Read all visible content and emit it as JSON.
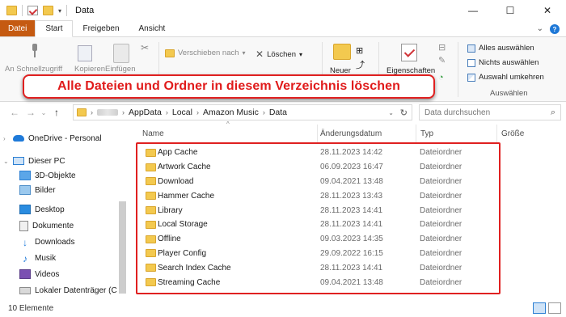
{
  "window": {
    "title": "Data",
    "controls": [
      "—",
      "☐",
      "✕"
    ]
  },
  "ribbon_tabs": {
    "file": "Datei",
    "start": "Start",
    "share": "Freigeben",
    "view": "Ansicht"
  },
  "ribbon": {
    "pin_label": "An Schnellzugriff",
    "copy_label": "Kopieren",
    "paste_label": "Einfügen",
    "move_to": "Verschieben nach",
    "delete": "Löschen",
    "new_label": "Neuer",
    "properties": "Eigenschaften",
    "select_all": "Alles auswählen",
    "select_none": "Nichts auswählen",
    "invert_selection": "Auswahl umkehren",
    "select_group": "Auswählen"
  },
  "callout": {
    "text": "Alle Dateien und Ordner in diesem Verzeichnis löschen"
  },
  "address": {
    "segments": [
      "AppData",
      "Local",
      "Amazon Music",
      "Data"
    ],
    "search_placeholder": "Data durchsuchen"
  },
  "nav": {
    "items": [
      {
        "label": "OneDrive - Personal",
        "icon": "cloud-icon"
      },
      {
        "label": "Dieser PC",
        "icon": "computer-icon"
      },
      {
        "label": "3D-Objekte",
        "icon": "3d-objects-icon"
      },
      {
        "label": "Bilder",
        "icon": "pictures-icon"
      },
      {
        "label": "Desktop",
        "icon": "desktop-icon"
      },
      {
        "label": "Dokumente",
        "icon": "documents-icon"
      },
      {
        "label": "Downloads",
        "icon": "download-icon"
      },
      {
        "label": "Musik",
        "icon": "music-icon"
      },
      {
        "label": "Videos",
        "icon": "videos-icon"
      },
      {
        "label": "Lokaler Datenträger (C",
        "icon": "drive-icon"
      }
    ]
  },
  "columns": {
    "name": "Name",
    "date": "Änderungsdatum",
    "type": "Typ",
    "size": "Größe"
  },
  "files": [
    {
      "name": "App Cache",
      "date": "28.11.2023 14:42",
      "type": "Dateiordner"
    },
    {
      "name": "Artwork Cache",
      "date": "06.09.2023 16:47",
      "type": "Dateiordner"
    },
    {
      "name": "Download",
      "date": "09.04.2021 13:48",
      "type": "Dateiordner"
    },
    {
      "name": "Hammer Cache",
      "date": "28.11.2023 13:43",
      "type": "Dateiordner"
    },
    {
      "name": "Library",
      "date": "28.11.2023 14:41",
      "type": "Dateiordner"
    },
    {
      "name": "Local Storage",
      "date": "28.11.2023 14:41",
      "type": "Dateiordner"
    },
    {
      "name": "Offline",
      "date": "09.03.2023 14:35",
      "type": "Dateiordner"
    },
    {
      "name": "Player Config",
      "date": "29.09.2022 16:15",
      "type": "Dateiordner"
    },
    {
      "name": "Search Index Cache",
      "date": "28.11.2023 14:41",
      "type": "Dateiordner"
    },
    {
      "name": "Streaming Cache",
      "date": "09.04.2021 13:48",
      "type": "Dateiordner"
    }
  ],
  "status": {
    "count": "10 Elemente"
  },
  "colors": {
    "accent_red": "#e02020",
    "file_tab": "#c55a11",
    "folder": "#f3c94f"
  }
}
